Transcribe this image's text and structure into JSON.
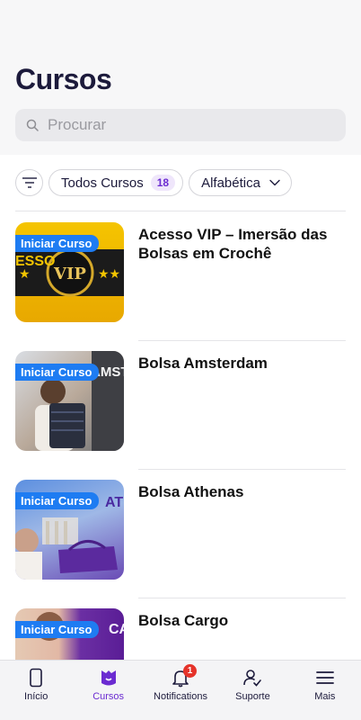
{
  "header": {
    "title": "Cursos"
  },
  "search": {
    "placeholder": "Procurar"
  },
  "filters": {
    "courses_label": "Todos Cursos",
    "courses_count": "18",
    "sort_label": "Alfabética"
  },
  "courses": [
    {
      "title": "Acesso VIP – Imersão das Bolsas em Crochê",
      "tag": "Iniciar Curso"
    },
    {
      "title": "Bolsa Amsterdam",
      "tag": "Iniciar Curso"
    },
    {
      "title": "Bolsa Athenas",
      "tag": "Iniciar Curso"
    },
    {
      "title": "Bolsa Cargo",
      "tag": "Iniciar Curso"
    }
  ],
  "thumb_text": {
    "vip": "VIP",
    "vip_side": "ESSO",
    "ams": "AMST",
    "ath": "ATI",
    "car": "CA"
  },
  "tabbar": {
    "items": [
      {
        "label": "Início",
        "icon": "tablet-icon"
      },
      {
        "label": "Cursos",
        "icon": "courses-icon"
      },
      {
        "label": "Notifications",
        "icon": "bell-icon",
        "badge": "1"
      },
      {
        "label": "Suporte",
        "icon": "support-icon"
      },
      {
        "label": "Mais",
        "icon": "menu-icon"
      }
    ]
  },
  "colors": {
    "accent": "#6b2bd1",
    "tag_blue": "#1e7cf2",
    "badge_red": "#e5332a"
  }
}
